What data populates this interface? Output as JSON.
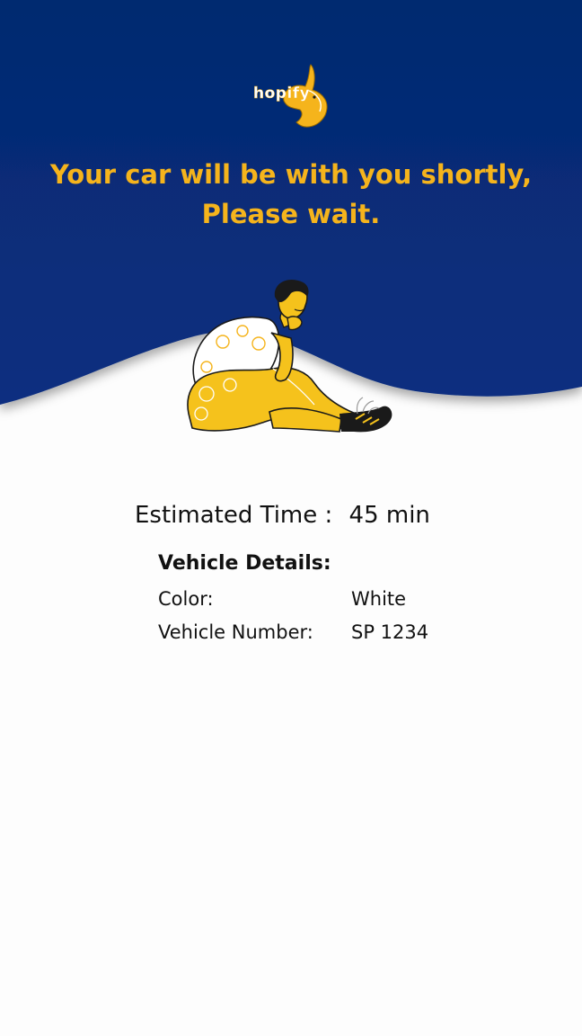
{
  "brand": {
    "logo_text": "hopify"
  },
  "header": {
    "line1": "Your car will be with you shortly,",
    "line2": "Please wait."
  },
  "estimate": {
    "label": "Estimated Time :",
    "value": "45 min"
  },
  "vehicle": {
    "title": "Vehicle Details:",
    "rows": [
      {
        "label": "Color:",
        "value": "White"
      },
      {
        "label": "Vehicle Number:",
        "value": "SP 1234"
      }
    ]
  },
  "colors": {
    "header_top": "#042a72",
    "header_bottom": "#0d2f82",
    "accent": "#f5b41c",
    "text": "#111111",
    "background": "#fdfdfd"
  },
  "icons": {
    "logo": "rabbit-logo-icon",
    "illustration": "waiting-person-illustration"
  }
}
